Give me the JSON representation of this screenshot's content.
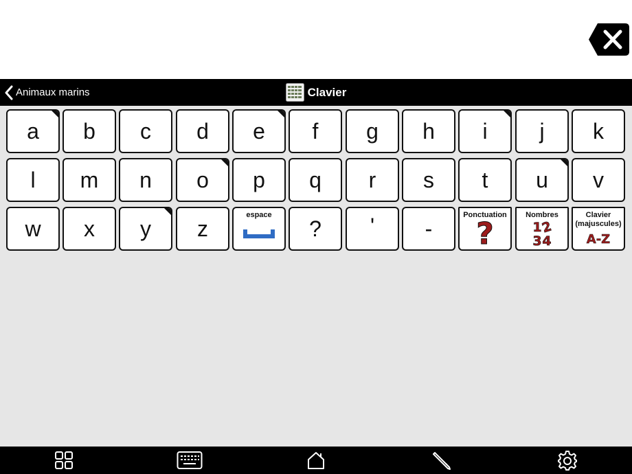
{
  "nav": {
    "back_label": "Animaux marins",
    "title": "Clavier"
  },
  "keyboard": {
    "row1": [
      "a",
      "b",
      "c",
      "d",
      "e",
      "f",
      "g",
      "h",
      "i",
      "j",
      "k"
    ],
    "row2": [
      "l",
      "m",
      "n",
      "o",
      "p",
      "q",
      "r",
      "s",
      "t",
      "u",
      "v"
    ],
    "row3": [
      "w",
      "x",
      "y",
      "z",
      "'",
      "-",
      "?"
    ],
    "space_label": "espace",
    "punctuation_label": "Ponctuation",
    "numbers_label": "Nombres",
    "uppercase_label": "Clavier (majuscules)",
    "uppercase_caption": "A-Z",
    "numbers_digits": [
      "1",
      "2",
      "3",
      "4"
    ],
    "punctuation_glyph": "?"
  },
  "icons": {
    "clear": "backspace-x-icon",
    "back": "chevron-left-icon",
    "title": "keyboard-grid-icon",
    "toolbar": [
      "grid-icon",
      "keyboard-icon",
      "home-icon",
      "pencil-icon",
      "gear-icon"
    ]
  },
  "colors": {
    "accent_red": "#9c1c1c",
    "space_blue": "#2f6cc4"
  }
}
